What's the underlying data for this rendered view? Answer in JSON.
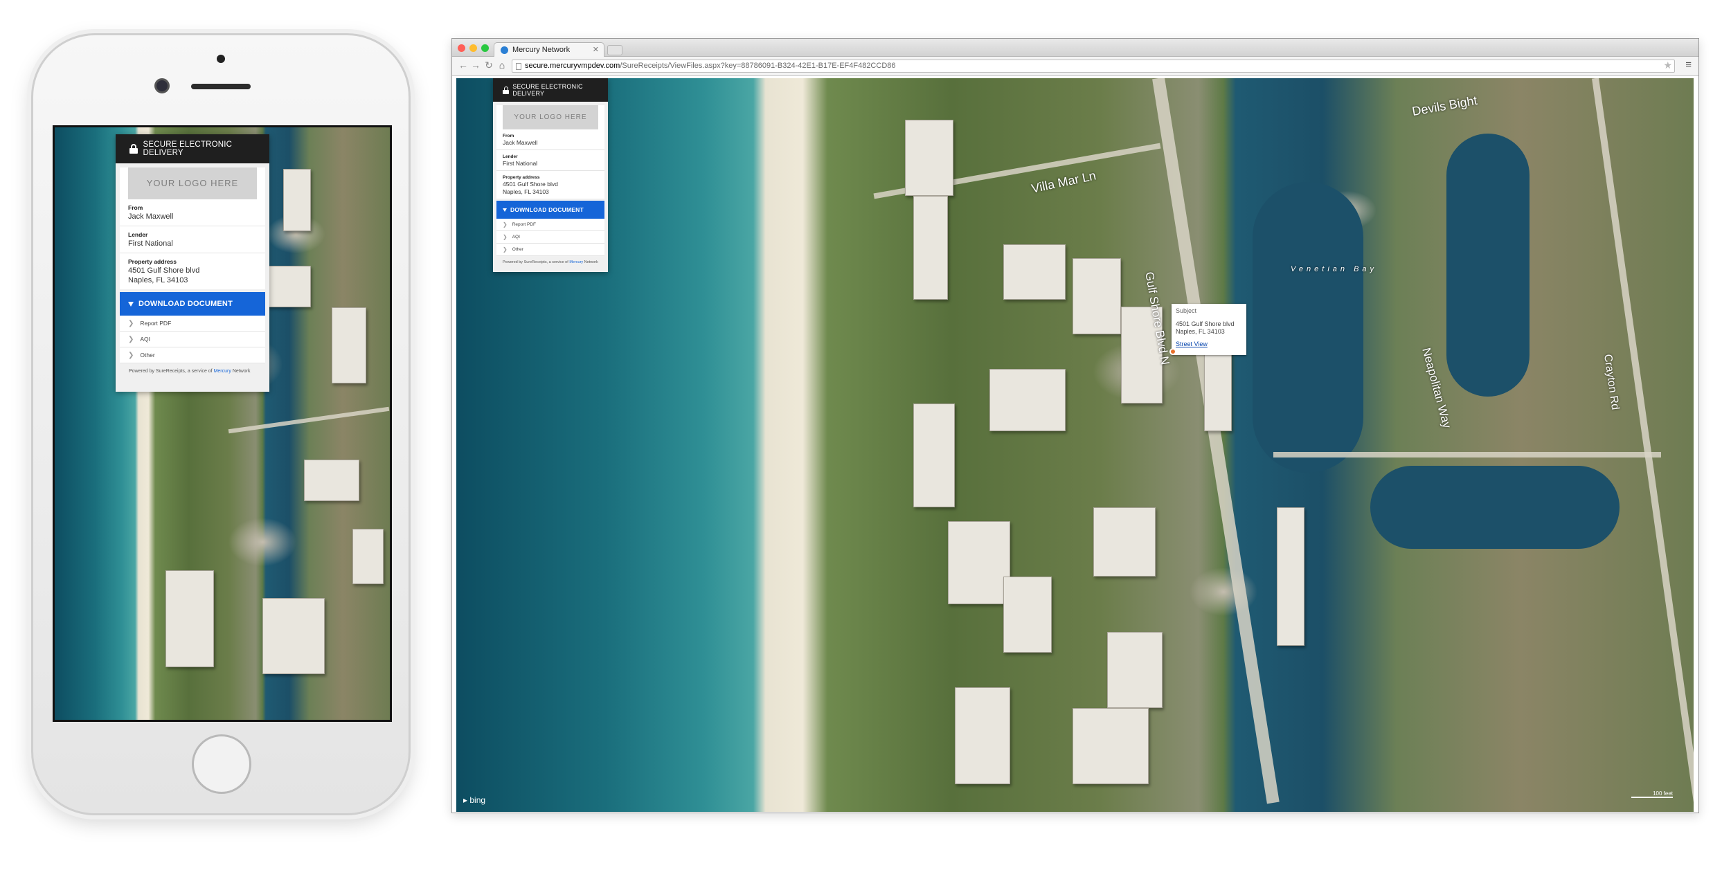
{
  "browser": {
    "tab_title": "Mercury Network",
    "url_domain": "secure.mercuryvmpdev.com",
    "url_path": "/SureReceipts/ViewFiles.aspx?key=88786091-B324-42E1-B17E-EF4F482CCD86"
  },
  "panel": {
    "header": "SECURE ELECTRONIC DELIVERY",
    "logo_placeholder": "YOUR LOGO HERE",
    "fields": {
      "from_label": "From",
      "from_value": "Jack Maxwell",
      "lender_label": "Lender",
      "lender_value": "First National",
      "address_label": "Property address",
      "address_line1": "4501 Gulf Shore blvd",
      "address_line2": "Naples, FL 34103"
    },
    "download_label": "DOWNLOAD DOCUMENT",
    "files": [
      "Report PDF",
      "AQI",
      "Other"
    ],
    "powered_prefix": "Powered by SureReceipts, a service of",
    "powered_brand": "Mercury",
    "powered_suffix": "Network"
  },
  "map": {
    "popup_title": "Subject",
    "popup_line1": "4501 Gulf Shore blvd",
    "popup_line2": "Naples, FL 34103",
    "popup_link": "Street View",
    "labels": [
      "Villa Mar Ln",
      "Gulf Shore Blvd N",
      "Venetian Bay",
      "Devils Bight",
      "Neapolitan Way",
      "Crayton Rd"
    ],
    "bing_label": "bing",
    "scale_label": "100 feet"
  },
  "colors": {
    "accent": "#1565d8",
    "header_bg": "#1f1f1f",
    "pin": "#e8702a",
    "dot_close": "#ff5f57",
    "dot_min": "#febc2e",
    "dot_max": "#28c840"
  }
}
